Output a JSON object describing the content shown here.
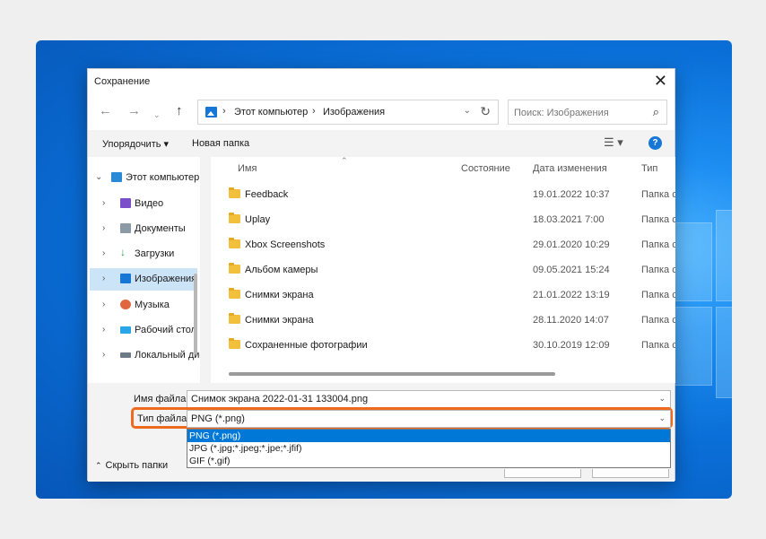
{
  "dialog": {
    "title": "Сохранение"
  },
  "address": {
    "root": "Этот компьютер",
    "folder": "Изображения"
  },
  "search": {
    "placeholder": "Поиск: Изображения"
  },
  "toolbar": {
    "organize": "Упорядочить ▾",
    "new_folder": "Новая папка"
  },
  "sidebar": {
    "items": [
      {
        "label": "Этот компьютер",
        "icon": "monitor-icon",
        "color": "#2a8ad8"
      },
      {
        "label": "Видео",
        "icon": "video-icon",
        "color": "#7a4fc9"
      },
      {
        "label": "Документы",
        "icon": "documents-icon",
        "color": "#8c9aa8"
      },
      {
        "label": "Загрузки",
        "icon": "download-icon",
        "color": "#2f9c57"
      },
      {
        "label": "Изображения",
        "icon": "pictures-icon",
        "color": "#1677d6"
      },
      {
        "label": "Музыка",
        "icon": "music-icon",
        "color": "#e0663f"
      },
      {
        "label": "Рабочий стол",
        "icon": "desktop-icon",
        "color": "#2aa6e8"
      },
      {
        "label": "Локальный дис",
        "icon": "drive-icon",
        "color": "#6c7a86"
      }
    ]
  },
  "columns": {
    "name": "Имя",
    "status": "Состояние",
    "date": "Дата изменения",
    "type": "Тип"
  },
  "files": [
    {
      "name": "Feedback",
      "date": "19.01.2022 10:37",
      "type": "Папка с"
    },
    {
      "name": "Uplay",
      "date": "18.03.2021 7:00",
      "type": "Папка с"
    },
    {
      "name": "Xbox Screenshots",
      "date": "29.01.2020 10:29",
      "type": "Папка с"
    },
    {
      "name": "Альбом камеры",
      "date": "09.05.2021 15:24",
      "type": "Папка с"
    },
    {
      "name": "Снимки экрана",
      "date": "21.01.2022 13:19",
      "type": "Папка с"
    },
    {
      "name": "Снимки экрана",
      "date": "28.11.2020 14:07",
      "type": "Папка с"
    },
    {
      "name": "Сохраненные фотографии",
      "date": "30.10.2019 12:09",
      "type": "Папка с"
    }
  ],
  "form": {
    "filename_label": "Имя файла:",
    "filename_value": "Снимок экрана 2022-01-31 133004.png",
    "filetype_label": "Тип файла:",
    "filetype_value": "PNG (*.png)",
    "filetype_options": [
      "PNG (*.png)",
      "JPG (*.jpg;*.jpeg;*.jpe;*.jfif)",
      "GIF (*.gif)"
    ]
  },
  "footer": {
    "hide_folders": "Скрыть папки"
  },
  "colors": {
    "accent": "#0078d7",
    "highlight_outline": "#ee6a1f",
    "folder": "#f3c03c"
  }
}
